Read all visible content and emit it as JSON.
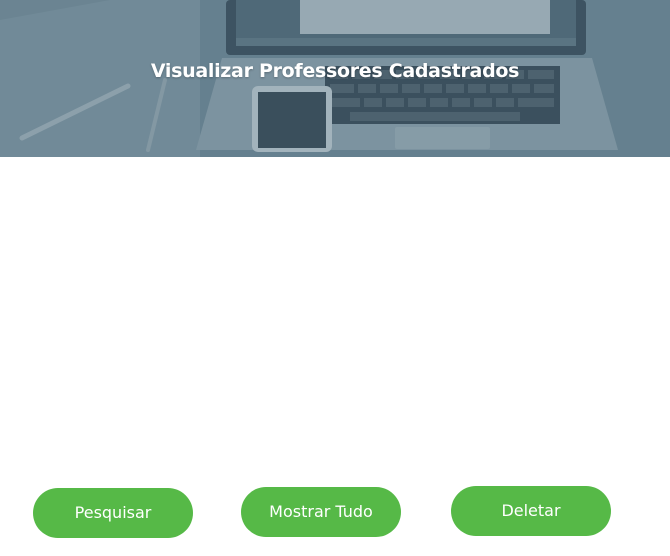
{
  "hero": {
    "title": "Visualizar Professores Cadastrados"
  },
  "actions": {
    "search_label": "Pesquisar",
    "show_all_label": "Mostrar Tudo",
    "delete_label": "Deletar"
  },
  "colors": {
    "button_green": "#56b947",
    "hero_tint": "#3c5f73",
    "text_on_dark": "#ffffff"
  }
}
